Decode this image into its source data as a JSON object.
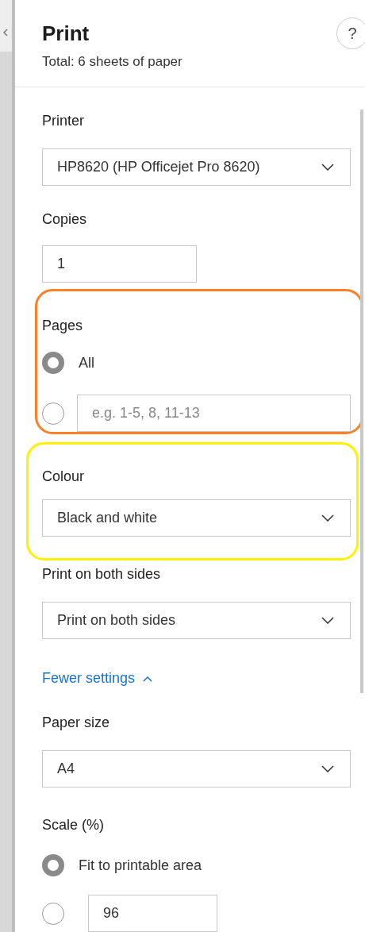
{
  "header": {
    "title": "Print",
    "subtitle": "Total: 6 sheets of paper",
    "help": "?"
  },
  "sections": [
    {
      "kind": "select",
      "label": "Printer",
      "value": "HP8620 (HP Officejet Pro 8620)"
    },
    {
      "kind": "input",
      "label": "Copies",
      "value": "1"
    },
    {
      "kind": "radios",
      "label": "Pages",
      "color": "#ff7f27",
      "options": [
        {
          "label": "All",
          "selected": true
        },
        {
          "placeholder": "e.g. 1-5, 8, 11-13",
          "selected": false
        }
      ]
    },
    {
      "kind": "select",
      "label": "Colour",
      "value": "Black and white",
      "color": "#fff200"
    },
    {
      "kind": "select",
      "label": "Print on both sides",
      "value": "Print on both sides"
    },
    {
      "kind": "link",
      "text": "Fewer settings",
      "expanded": true
    },
    {
      "kind": "select",
      "label": "Paper size",
      "value": "A4"
    },
    {
      "kind": "radios",
      "label": "Scale (%)",
      "options": [
        {
          "label": "Fit to printable area",
          "selected": true
        },
        {
          "value": "96",
          "selected": false
        }
      ]
    }
  ]
}
